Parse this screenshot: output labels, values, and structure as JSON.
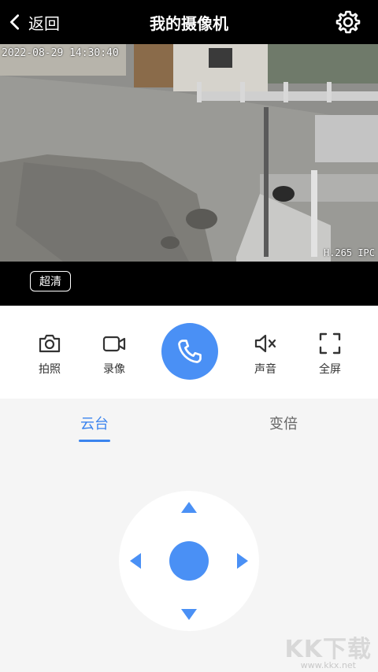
{
  "header": {
    "back_label": "返回",
    "title": "我的摄像机",
    "back_icon": "chevron-left-icon",
    "settings_icon": "gear-icon"
  },
  "video": {
    "timestamp": "2022-08-29 14:30:40",
    "codec": "H.265 IPC",
    "quality_label": "超清"
  },
  "toolbar": {
    "items": [
      {
        "label": "拍照",
        "icon": "camera-icon"
      },
      {
        "label": "录像",
        "icon": "video-camera-icon"
      },
      {
        "label": "声音",
        "icon": "speaker-mute-icon"
      },
      {
        "label": "全屏",
        "icon": "fullscreen-icon"
      }
    ],
    "call_icon": "phone-icon"
  },
  "tabs": [
    {
      "label": "云台",
      "active": true
    },
    {
      "label": "变倍",
      "active": false
    }
  ],
  "ptz": {
    "icons": [
      "arrow-up-icon",
      "arrow-down-icon",
      "arrow-left-icon",
      "arrow-right-icon"
    ]
  },
  "watermark": {
    "logo": "KK下载",
    "site": "www.kkx.net"
  },
  "colors": {
    "accent": "#4a90f5",
    "tab_active": "#3b84ee",
    "header_bg": "#000000",
    "page_bg": "#f5f5f5"
  }
}
